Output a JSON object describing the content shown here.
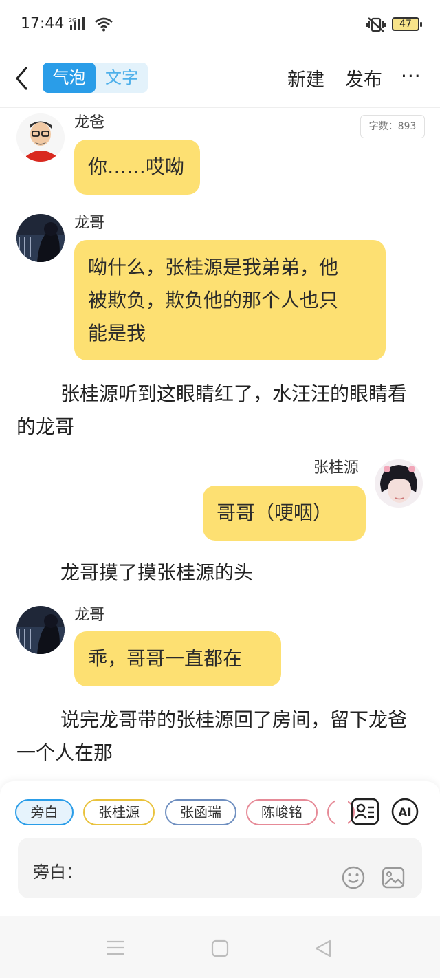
{
  "status_bar": {
    "time": "17:44",
    "network": "2G",
    "battery": "47"
  },
  "nav": {
    "back_icon": "chevron-left-icon",
    "toggle": {
      "selected": "气泡",
      "other": "文字"
    },
    "new_label": "新建",
    "publish_label": "发布",
    "more_icon": "more-horizontal-icon",
    "more_glyph": "···"
  },
  "word_count": "字数：893",
  "messages": [
    {
      "speaker": "龙爸",
      "lines": [
        "你……哎呦"
      ]
    },
    {
      "speaker": "龙哥",
      "lines": [
        "呦什么，张桂源是我弟弟，他",
        "被欺负，欺负他的那个人也只",
        "能是我"
      ]
    },
    {
      "narration": "张桂源听到这眼睛红了，水汪汪的眼睛看的龙哥"
    },
    {
      "speaker": "张桂源",
      "lines": [
        "哥哥（哽咽）"
      ]
    },
    {
      "narration": "龙哥摸了摸张桂源的头"
    },
    {
      "speaker": "龙哥",
      "lines": [
        "乖，哥哥一直都在"
      ]
    },
    {
      "narration": "说完龙哥带的张桂源回了房间，留下龙爸一个人在那"
    }
  ],
  "roles": [
    {
      "label": "旁白",
      "color": "#2a9de8",
      "selected": true
    },
    {
      "label": "张桂源",
      "color": "#e9c23c"
    },
    {
      "label": "张函瑞",
      "color": "#6f8fc0"
    },
    {
      "label": "陈峻铭",
      "color": "#e68a97"
    },
    {
      "label": "",
      "color": "#e68a97"
    }
  ],
  "tools": {
    "roles_icon": "character-card-icon",
    "ai_label": "AI"
  },
  "input": {
    "prefix": "旁白：",
    "emoji_icon": "smiley-icon",
    "image_icon": "image-icon"
  },
  "system_nav": {
    "menu_icon": "menu-icon",
    "home_icon": "home-square-icon",
    "back_icon": "back-triangle-icon"
  },
  "colors": {
    "accent": "#2a9de8",
    "bubble": "#fde072"
  }
}
